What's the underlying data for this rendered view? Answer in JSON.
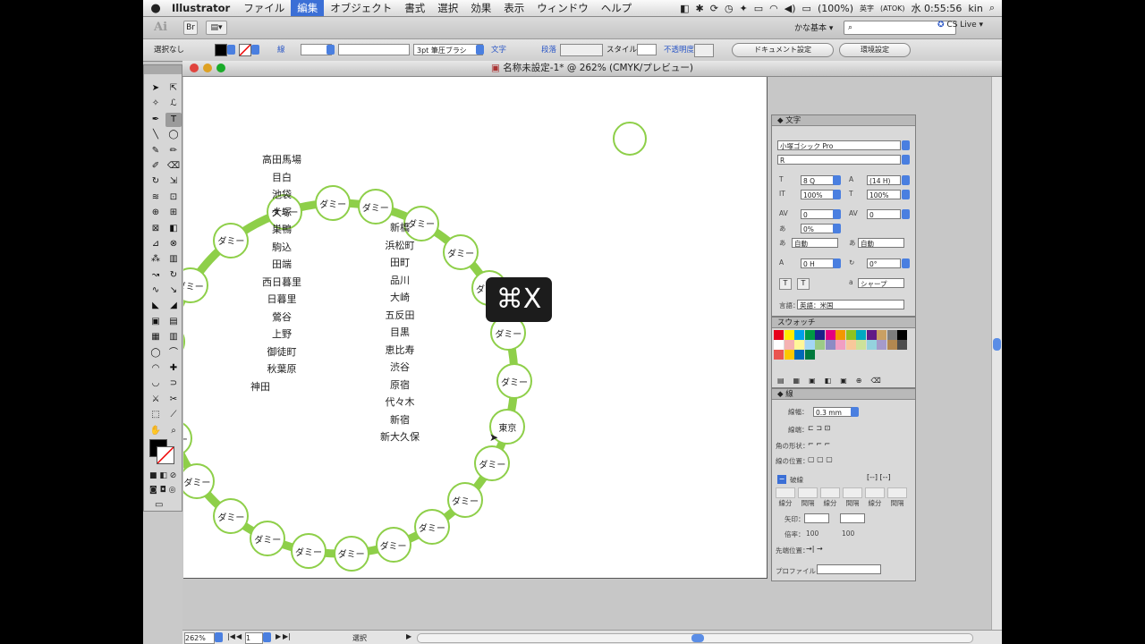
{
  "menubar": {
    "app": "Illustrator",
    "items": [
      "ファイル",
      "編集",
      "オブジェクト",
      "書式",
      "選択",
      "効果",
      "表示",
      "ウィンドウ",
      "ヘルプ"
    ],
    "active_index": 1,
    "battery": "(100%)",
    "input_label": "英字",
    "atok": "(ATOK)",
    "clock": "水 0:55:56",
    "user": "kin"
  },
  "appbar": {
    "logo": "Ai",
    "br": "Br",
    "workspace": "かな基本 ▾",
    "search_placeholder": "",
    "cslive": "CS Live ▾"
  },
  "controlbar": {
    "selection": "選択なし",
    "stroke_label": "線",
    "brush": "3pt 筆圧ブラシ",
    "char": "文字",
    "para": "段落",
    "style": "スタイル：",
    "opacity": "不透明度",
    "doc_settings": "ドキュメント設定",
    "prefs": "環境設定"
  },
  "document": {
    "title": "名称未設定-1* @ 262% (CMYK/プレビュー)",
    "zoom": "262%",
    "page": "1",
    "status": "選択"
  },
  "overlay": {
    "shortcut": "⌘X"
  },
  "stations_left": [
    "高田馬場",
    "目白",
    "池袋",
    "大塚",
    "巣鴨",
    "駒込",
    "田端",
    "西日暮里",
    "日暮里",
    "鶯谷",
    "上野",
    "御徒町",
    "秋葉原",
    "神田"
  ],
  "stations_right": [
    "新橋",
    "浜松町",
    "田町",
    "品川",
    "大崎",
    "五反田",
    "目黒",
    "恵比寿",
    "渋谷",
    "原宿",
    "代々木",
    "新宿",
    "新大久保"
  ],
  "bubbles": {
    "dummy": "ダミー",
    "tokyo": "東京"
  },
  "char_panel": {
    "tab": "文字",
    "font": "小塚ゴシック Pro",
    "style": "R",
    "size": "8 Q",
    "leading": "(14 H)",
    "vscale": "100%",
    "hscale": "100%",
    "kern": "0",
    "track": "0",
    "tsume": "0%",
    "aki1": "自動",
    "aki2": "自動",
    "baseline": "0 H",
    "rotate": "0°",
    "aa": "シャープ",
    "lang_label": "言語：",
    "lang": "英語：米国"
  },
  "swatch_panel": {
    "tab": "スウォッチ",
    "colors": [
      "#e6001a",
      "#ffed00",
      "#00a0e9",
      "#009944",
      "#1d2088",
      "#e4007f",
      "#f39800",
      "#8fc31f",
      "#00a7c2",
      "#601986",
      "#c9a063",
      "#7d7d7d",
      "#000000",
      "#ffffff",
      "#f5b2b2",
      "#fff799",
      "#a3d6f5",
      "#9ccb86",
      "#8c8bc4",
      "#f19ec2",
      "#f8c89a",
      "#cde29a",
      "#94d2de",
      "#a59aca",
      "#b28850",
      "#4d4d4d",
      "#ea5550",
      "#fcc800",
      "#0068b7",
      "#00793d"
    ]
  },
  "stroke_panel": {
    "tab": "線",
    "weight_label": "線幅：",
    "weight": "0.3 mm",
    "cap_label": "線端：",
    "corner_label": "角の形状：",
    "align_label": "線の位置：",
    "dash_label": "破線",
    "dash_cells": [
      "線分",
      "間隔",
      "線分",
      "間隔",
      "線分",
      "間隔"
    ],
    "arrow_label": "矢印：",
    "scale_label": "倍率：",
    "scale1": "100",
    "scale2": "100",
    "tip_label": "先端位置：",
    "profile_label": "プロファイル："
  }
}
